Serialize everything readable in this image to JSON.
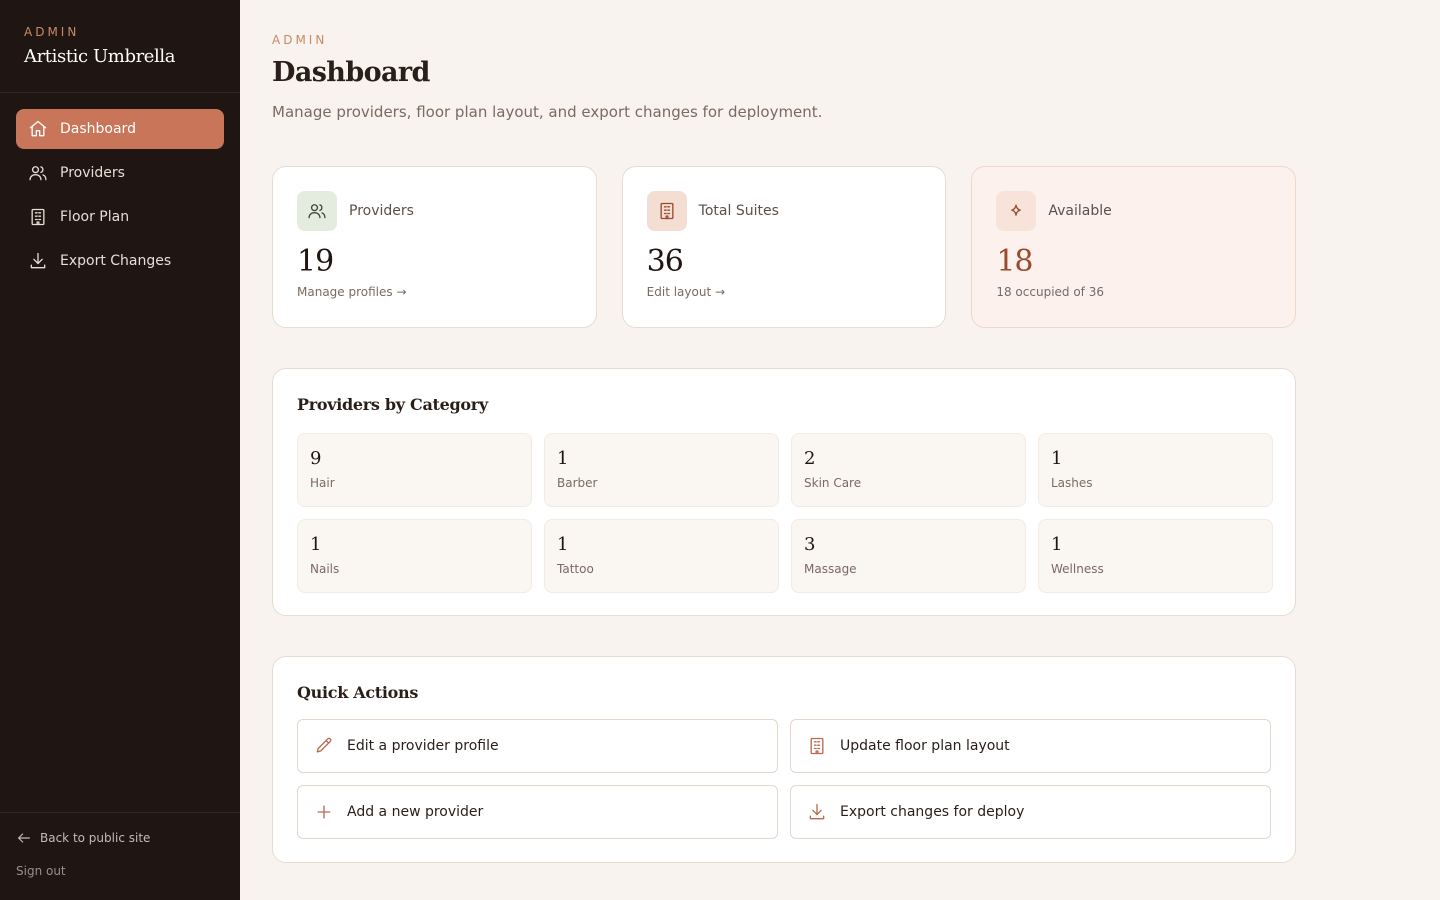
{
  "brand": {
    "kicker": "ADMIN",
    "name": "Artistic Umbrella"
  },
  "nav": [
    {
      "label": "Dashboard",
      "icon": "home-icon",
      "active": true
    },
    {
      "label": "Providers",
      "icon": "users-icon",
      "active": false
    },
    {
      "label": "Floor Plan",
      "icon": "building-icon",
      "active": false
    },
    {
      "label": "Export Changes",
      "icon": "download-icon",
      "active": false
    }
  ],
  "footer": {
    "back_label": "Back to public site",
    "signout_label": "Sign out"
  },
  "header": {
    "kicker": "ADMIN",
    "title": "Dashboard",
    "subtitle": "Manage providers, floor plan layout, and export changes for deployment."
  },
  "stats": [
    {
      "label": "Providers",
      "value": "19",
      "link": "Manage profiles →",
      "icon": "users-icon"
    },
    {
      "label": "Total Suites",
      "value": "36",
      "link": "Edit layout →",
      "icon": "building-icon"
    },
    {
      "label": "Available",
      "value": "18",
      "link": "18 occupied of 36",
      "icon": "sparkle-icon"
    }
  ],
  "categories": {
    "title": "Providers by Category",
    "items": [
      {
        "count": "9",
        "label": "Hair"
      },
      {
        "count": "1",
        "label": "Barber"
      },
      {
        "count": "2",
        "label": "Skin Care"
      },
      {
        "count": "1",
        "label": "Lashes"
      },
      {
        "count": "1",
        "label": "Nails"
      },
      {
        "count": "1",
        "label": "Tattoo"
      },
      {
        "count": "3",
        "label": "Massage"
      },
      {
        "count": "1",
        "label": "Wellness"
      }
    ]
  },
  "quick_actions": {
    "title": "Quick Actions",
    "items": [
      {
        "label": "Edit a provider profile",
        "icon": "pencil-icon"
      },
      {
        "label": "Update floor plan layout",
        "icon": "building-icon"
      },
      {
        "label": "Add a new provider",
        "icon": "plus-icon"
      },
      {
        "label": "Export changes for deploy",
        "icon": "download-icon"
      }
    ]
  },
  "colors": {
    "sidebar_bg": "#1f1512",
    "accent": "#c8755a",
    "page_bg": "#f8f3ee",
    "kicker": "#c98a64"
  }
}
